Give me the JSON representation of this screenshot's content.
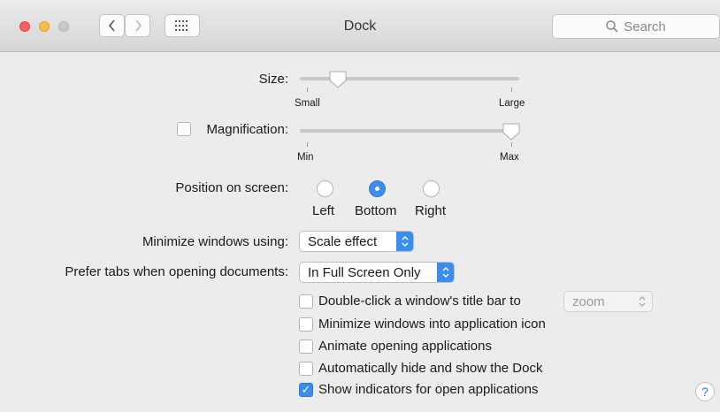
{
  "window": {
    "title": "Dock"
  },
  "toolbar": {
    "search_placeholder": "Search"
  },
  "size": {
    "label": "Size:",
    "min_label": "Small",
    "max_label": "Large",
    "value": 0.15
  },
  "magnification": {
    "label": "Magnification:",
    "checked": false,
    "min_label": "Min",
    "max_label": "Max",
    "value": 1.0
  },
  "position": {
    "label": "Position on screen:",
    "options": [
      "Left",
      "Bottom",
      "Right"
    ],
    "selected": "Bottom"
  },
  "minimize": {
    "label": "Minimize windows using:",
    "value": "Scale effect"
  },
  "prefer_tabs": {
    "label": "Prefer tabs when opening documents:",
    "value": "In Full Screen Only"
  },
  "double_click": {
    "label": "Double-click a window's title bar to",
    "checked": false,
    "value": "zoom"
  },
  "checkboxes": [
    {
      "label": "Minimize windows into application icon",
      "checked": false
    },
    {
      "label": "Animate opening applications",
      "checked": false
    },
    {
      "label": "Automatically hide and show the Dock",
      "checked": false
    },
    {
      "label": "Show indicators for open applications",
      "checked": true
    }
  ],
  "help": {
    "label": "?"
  },
  "colors": {
    "accent": "#3b8ef1",
    "close": "#fc605b",
    "minimize": "#fdbc40",
    "zoom": "#c9c9c9"
  }
}
